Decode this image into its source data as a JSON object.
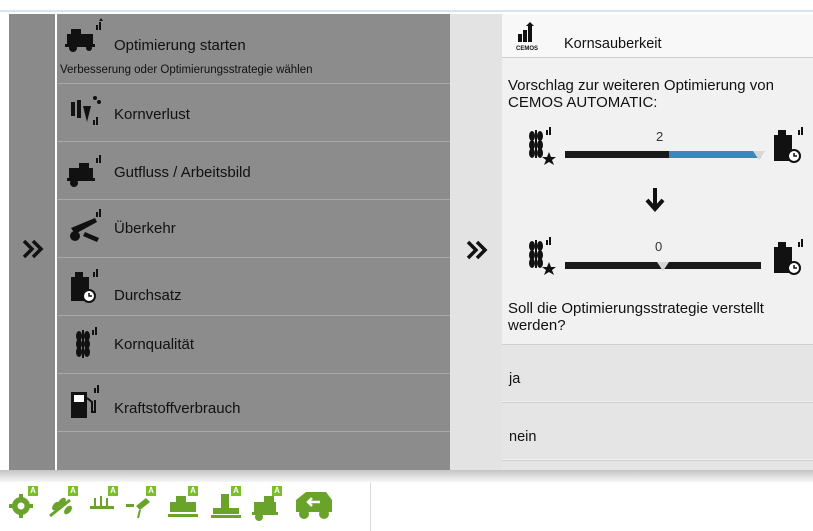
{
  "menu": {
    "title": "Optimierung starten",
    "subtitle": "Verbesserung oder Optimierungsstrategie wählen",
    "items": [
      {
        "label": "Kornverlust",
        "icon": "grain-loss-icon"
      },
      {
        "label": "Gutfluss / Arbeitsbild",
        "icon": "crop-flow-icon"
      },
      {
        "label": "Überkehr",
        "icon": "returns-icon"
      },
      {
        "label": "Durchsatz",
        "icon": "throughput-weight-icon"
      },
      {
        "label": "Kornqualität",
        "icon": "grain-quality-icon"
      },
      {
        "label": "Kraftstoffverbrauch",
        "icon": "fuel-pump-icon"
      }
    ]
  },
  "dialog": {
    "title": "Kornsauberkeit",
    "header_icon_label": "CEMOS",
    "proposal_text": "Vorschlag zur weiteren Optimierung von CEMOS AUTOMATIC:",
    "slider_current": {
      "value": "2",
      "position_fraction": 1.0,
      "fill_fraction": 0.55
    },
    "slider_proposed": {
      "value": "0",
      "position_fraction": 0.5
    },
    "question": "Soll die Optimierungsstrategie verstellt werden?",
    "options": [
      "ja",
      "nein"
    ]
  },
  "colors": {
    "accent_green": "#7abf2a",
    "slider_blue": "#3b87b5",
    "menu_gray": "#8c8c8c"
  },
  "bottom_bar": {
    "buttons": [
      {
        "icon": "settings-auto-icon",
        "badge": "A"
      },
      {
        "icon": "crop-auto-icon",
        "badge": "A"
      },
      {
        "icon": "cutterbar-auto-icon",
        "badge": "A"
      },
      {
        "icon": "threshing-auto-icon",
        "badge": "A"
      },
      {
        "icon": "cleaning-auto-icon",
        "badge": "A"
      },
      {
        "icon": "separation-auto-icon",
        "badge": "A"
      },
      {
        "icon": "unloading-auto-icon",
        "badge": "A"
      },
      {
        "icon": "combine-return-icon",
        "badge": ""
      }
    ]
  }
}
